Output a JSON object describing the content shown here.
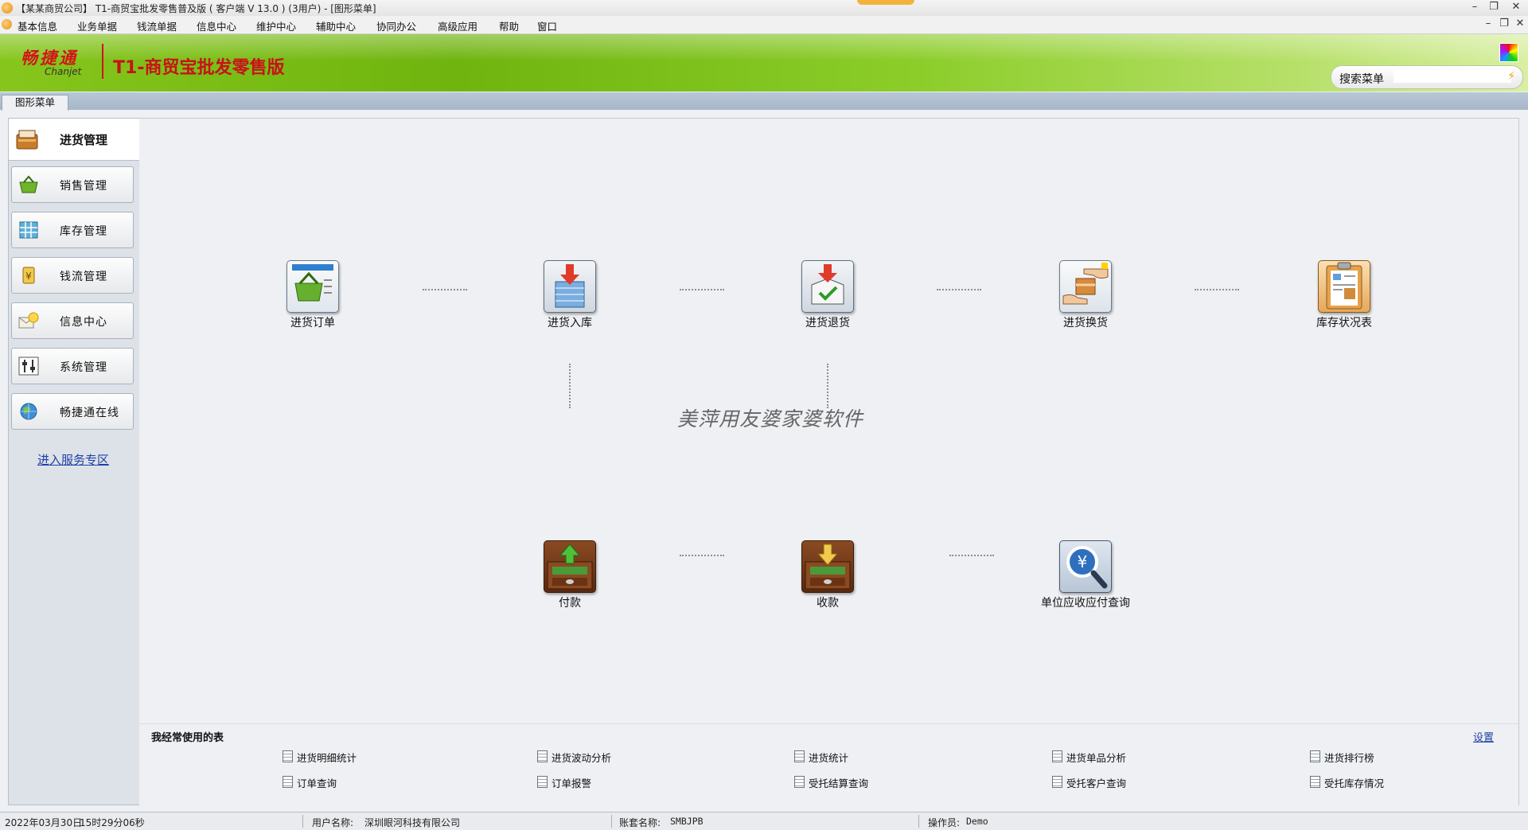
{
  "window": {
    "title": "【某某商贸公司】 T1-商贸宝批发零售普及版 ( 客户端 V 13.0 ) (3用户) - [图形菜单]",
    "controls": [
      "–",
      "❐",
      "✕"
    ]
  },
  "menubar": {
    "items": [
      "基本信息",
      "业务单据",
      "钱流单据",
      "信息中心",
      "维护中心",
      "辅助中心",
      "协同办公",
      "高级应用",
      "帮助",
      "窗口"
    ],
    "controls": [
      "–",
      "❐",
      "✕"
    ]
  },
  "banner": {
    "brand_cn": "畅捷通",
    "brand_en": "Chanjet",
    "product": "T1-商贸宝批发零售版",
    "search_label": "搜索菜单",
    "search_value": ""
  },
  "tabs": [
    "图形菜单"
  ],
  "sidebar": {
    "active": {
      "label": "进货管理",
      "icon": "purchase-icon"
    },
    "items": [
      {
        "label": "销售管理",
        "icon": "basket-icon"
      },
      {
        "label": "库存管理",
        "icon": "grid-icon"
      },
      {
        "label": "钱流管理",
        "icon": "money-icon"
      },
      {
        "label": "信息中心",
        "icon": "mail-bulb-icon"
      },
      {
        "label": "系统管理",
        "icon": "sliders-icon"
      },
      {
        "label": "畅捷通在线",
        "icon": "globe-icon"
      }
    ],
    "service_link": "进入服务专区"
  },
  "flow": {
    "watermark": "美萍用友婆家婆软件",
    "nodes": [
      {
        "label": "进货订单",
        "icon": "purchase-order-icon"
      },
      {
        "label": "进货入库",
        "icon": "stock-in-icon"
      },
      {
        "label": "进货退货",
        "icon": "purchase-return-icon"
      },
      {
        "label": "进货换货",
        "icon": "purchase-exchange-icon"
      },
      {
        "label": "库存状况表",
        "icon": "inventory-report-icon"
      },
      {
        "label": "付款",
        "icon": "payment-icon"
      },
      {
        "label": "收款",
        "icon": "receipt-icon"
      },
      {
        "label": "单位应收应付查询",
        "icon": "receivable-query-icon"
      }
    ]
  },
  "frequent": {
    "title": "我经常使用的表",
    "settings": "设置",
    "items": [
      "进货明细统计",
      "进货波动分析",
      "进货统计",
      "进货单品分析",
      "进货排行榜",
      "订单查询",
      "订单报警",
      "受托结算查询",
      "受托客户查询",
      "受托库存情况"
    ]
  },
  "status": {
    "date": "2022年03月30日",
    "time": "15时29分06秒",
    "user_label": "用户名称:",
    "user_value": "深圳眼河科技有限公司",
    "account_label": "账套名称:",
    "account_value": "SMBJPB",
    "operator_label": "操作员:",
    "operator_value": "Demo"
  }
}
